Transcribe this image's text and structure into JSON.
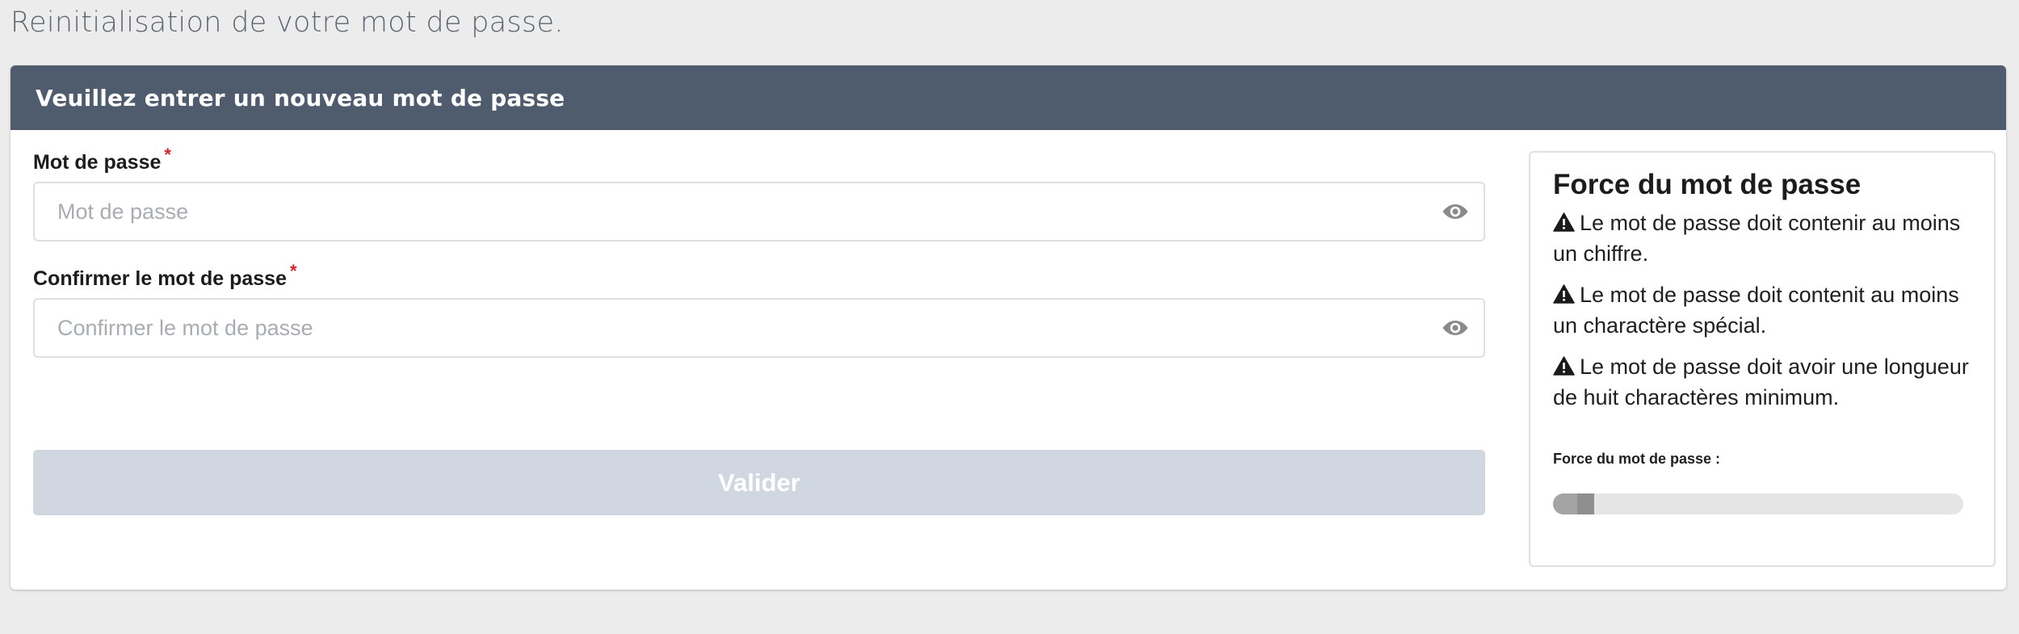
{
  "page": {
    "heading": "Reinitialisation de votre mot de passe."
  },
  "card": {
    "header_title": "Veuillez entrer un nouveau mot de passe"
  },
  "form": {
    "password": {
      "label": "Mot de passe",
      "required_mark": "*",
      "placeholder": "Mot de passe",
      "value": ""
    },
    "confirm_password": {
      "label": "Confirmer le mot de passe",
      "required_mark": "*",
      "placeholder": "Confirmer le mot de passe",
      "value": ""
    },
    "submit_label": "Valider"
  },
  "strength": {
    "title": "Force du mot de passe",
    "rules": [
      {
        "icon": "warning-icon",
        "text": "Le mot de passe doit contenir au moins un chiffre."
      },
      {
        "icon": "warning-icon",
        "text": "Le mot de passe doit contenit au moins un charactère spécial."
      },
      {
        "icon": "warning-icon",
        "text": "Le mot de passe doit avoir une longueur de huit charactères minimum."
      }
    ],
    "meter_label": "Force du mot de passe :",
    "meter_level_percent": 10
  },
  "colors": {
    "header_bg": "#4e5c6d",
    "page_bg": "#ececec",
    "required": "#d3232b",
    "button_disabled_bg": "#d0d7e0",
    "meter_fill": "#8f8f8f",
    "meter_track": "#e5e5e5"
  }
}
